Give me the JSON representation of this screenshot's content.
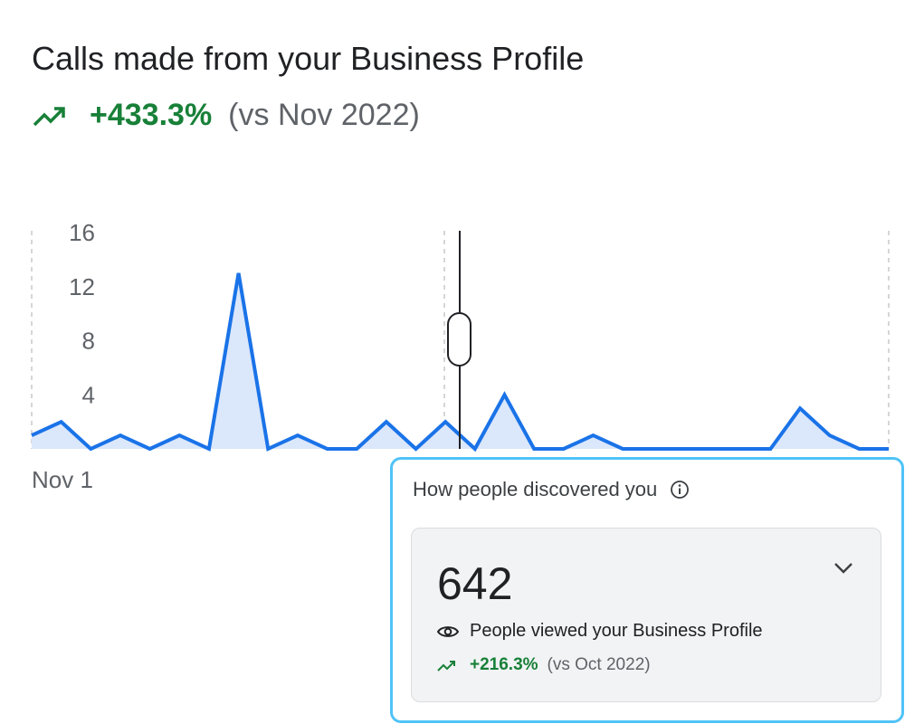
{
  "header": {
    "title": "Calls made from your Business Profile",
    "delta": "+433.3%",
    "comparison": "(vs Nov 2022)"
  },
  "chart_data": {
    "type": "area",
    "series": [
      {
        "values": [
          1,
          2,
          0,
          1,
          0,
          1,
          0,
          13,
          0,
          1,
          0,
          0,
          2,
          0,
          2,
          0,
          4,
          0,
          0,
          1,
          0,
          0,
          0,
          0,
          0,
          0,
          3,
          1,
          0,
          0
        ]
      }
    ],
    "y_ticks": [
      "16",
      "12",
      "8",
      "4"
    ],
    "ylim": [
      0,
      16
    ],
    "x_tick_labels": [
      "Nov 1"
    ],
    "grid": "dashed vertical",
    "color": "#1a73e8"
  },
  "discovery": {
    "title": "How people discovered you",
    "info_icon": "info-icon",
    "count": "642",
    "metric_label": "People viewed your Business Profile",
    "delta": "+216.3%",
    "comparison": "(vs Oct 2022)"
  },
  "colors": {
    "positive": "#188038",
    "line": "#1a73e8",
    "fill": "#dbe7fb",
    "highlight_border": "#4fc3f7"
  }
}
